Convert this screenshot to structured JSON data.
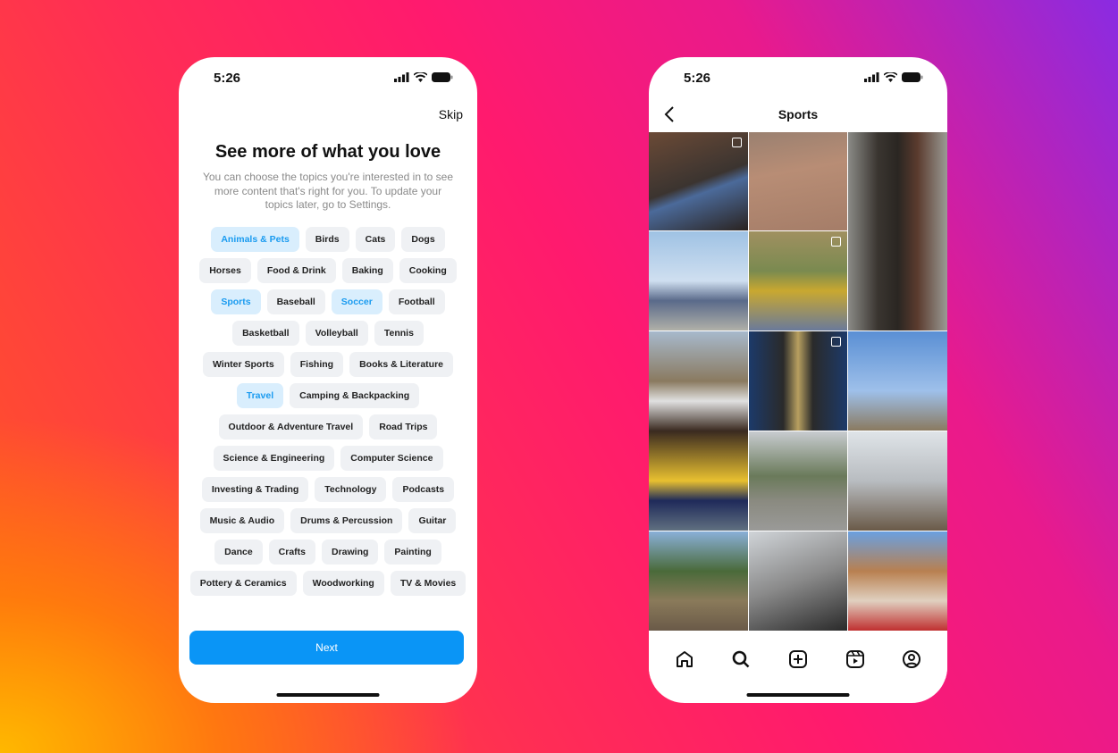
{
  "left_phone": {
    "time": "5:26",
    "skip_label": "Skip",
    "title": "See more of what you love",
    "subtitle": "You can choose the topics you're interested in to see more content that's right for you. To update your topics later, go to Settings.",
    "topic_rows": [
      [
        {
          "label": "Animals & Pets",
          "selected": true
        },
        {
          "label": "Birds"
        },
        {
          "label": "Cats"
        },
        {
          "label": "Dogs"
        }
      ],
      [
        {
          "label": "Horses"
        },
        {
          "label": "Food & Drink"
        },
        {
          "label": "Baking"
        },
        {
          "label": "Cooking"
        }
      ],
      [
        {
          "label": "Sports",
          "selected": true
        },
        {
          "label": "Baseball"
        },
        {
          "label": "Soccer",
          "selected": true
        },
        {
          "label": "Football"
        }
      ],
      [
        {
          "label": "Basketball"
        },
        {
          "label": "Volleyball"
        },
        {
          "label": "Tennis"
        }
      ],
      [
        {
          "label": "Winter Sports"
        },
        {
          "label": "Fishing"
        },
        {
          "label": "Books & Literature"
        }
      ],
      [
        {
          "label": "Travel",
          "selected": true
        },
        {
          "label": "Camping & Backpacking"
        }
      ],
      [
        {
          "label": "Outdoor & Adventure Travel"
        },
        {
          "label": "Road Trips"
        }
      ],
      [
        {
          "label": "Science & Engineering"
        },
        {
          "label": "Computer Science"
        }
      ],
      [
        {
          "label": "Investing & Trading"
        },
        {
          "label": "Technology"
        },
        {
          "label": "Podcasts"
        }
      ],
      [
        {
          "label": "Music & Audio"
        },
        {
          "label": "Drums & Percussion"
        },
        {
          "label": "Guitar"
        }
      ],
      [
        {
          "label": "Dance"
        },
        {
          "label": "Crafts"
        },
        {
          "label": "Drawing"
        },
        {
          "label": "Painting"
        }
      ],
      [
        {
          "label": "Pottery & Ceramics"
        },
        {
          "label": "Woodworking"
        },
        {
          "label": "TV & Movies"
        }
      ]
    ],
    "next_label": "Next",
    "accent": "#0a95f6"
  },
  "right_phone": {
    "time": "5:26",
    "title": "Sports",
    "nav_icons": [
      "home-icon",
      "search-icon",
      "create-icon",
      "reels-icon",
      "profile-icon"
    ]
  }
}
